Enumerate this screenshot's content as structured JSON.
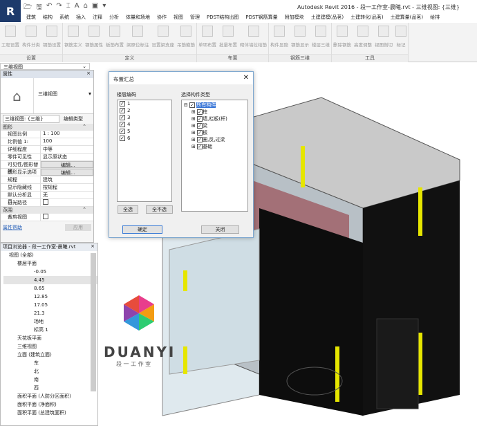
{
  "app": {
    "logo": "R",
    "title": "Autodesk Revit 2016 -   段一工作室-晨曦.rvt - 三维视图: {三维}"
  },
  "tabs": [
    "建筑",
    "结构",
    "系统",
    "插入",
    "注释",
    "分析",
    "体量和场地",
    "协作",
    "视图",
    "管理",
    "PDST结构出图",
    "PDST钢筋算量",
    "附加模块",
    "土建建模(品茗)",
    "土建转化(品茗)",
    "土建算量(品茗)",
    "给排"
  ],
  "ribbon": {
    "panels": [
      {
        "label": "设置",
        "buttons": [
          "工程设置",
          "构件分类",
          "钢筋设置"
        ]
      },
      {
        "label": "定义",
        "buttons": [
          "钢筋定义",
          "钢筋属性",
          "板筋布置",
          "梁原位标注",
          "设置梁支座",
          "吊筋箍筋"
        ]
      },
      {
        "label": "布置",
        "buttons": [
          "单项布置",
          "批量布置",
          "砌体墙拉结筋"
        ]
      },
      {
        "label": "钢筋三维",
        "buttons": [
          "构件显隐",
          "钢筋显示",
          "楼层三维"
        ]
      },
      {
        "label": "工具",
        "buttons": [
          "删除钢筋",
          "高度调整",
          "视图剖切",
          "标记"
        ]
      }
    ]
  },
  "view_selector": "三维视图",
  "properties": {
    "title": "属性",
    "type_name": "三维视图",
    "instance": "三维视图: {三维}",
    "edit_type": "编辑类型",
    "group1": "图形",
    "rows": [
      [
        "视图比例",
        "1 : 100"
      ],
      [
        "比例值 1:",
        "100"
      ],
      [
        "详细程度",
        "中等"
      ],
      [
        "零件可见性",
        "显示原状态"
      ],
      [
        "可见性/图形替换",
        "编辑..."
      ],
      [
        "图形显示选项",
        "编辑..."
      ],
      [
        "规程",
        "建筑"
      ],
      [
        "显示隐藏线",
        "按规程"
      ],
      [
        "默认分析显示...",
        "无"
      ],
      [
        "日光路径",
        ""
      ]
    ],
    "group2": "范围",
    "rows2": [
      [
        "裁剪视图",
        ""
      ]
    ],
    "help": "属性帮助",
    "apply": "应用"
  },
  "browser": {
    "title": "项目浏览器 - 段一工作室-晨曦.rvt",
    "root": "视图 (全部)",
    "floor_plans": "楼层平面",
    "levels": [
      "-0.05",
      "4.45",
      "8.65",
      "12.85",
      "17.05",
      "21.3",
      "场地",
      "标高 1"
    ],
    "ceiling": "天花板平面",
    "three_d": "三维视图",
    "elev": "立面 (建筑立面)",
    "elevs": [
      "东",
      "北",
      "南",
      "西"
    ],
    "area": [
      "面积平面 (人防分区面积)",
      "面积平面 (净面积)",
      "面积平面 (总建筑面积)"
    ]
  },
  "dialog": {
    "title": "布置汇总",
    "floor_label": "楼层编码",
    "floors": [
      "1",
      "2",
      "3",
      "4",
      "5",
      "6"
    ],
    "type_label": "选择构件类型",
    "root": "所有构件",
    "types": [
      "柱",
      "墙,栏板(杆)",
      "梁",
      "板",
      "圈,反,过梁",
      "基础"
    ],
    "select_all": "全选",
    "select_none": "全不选",
    "ok": "确定",
    "close": "关闭"
  },
  "watermark": {
    "brand": "DUANYI",
    "sub": "段 一 工 作 室"
  }
}
